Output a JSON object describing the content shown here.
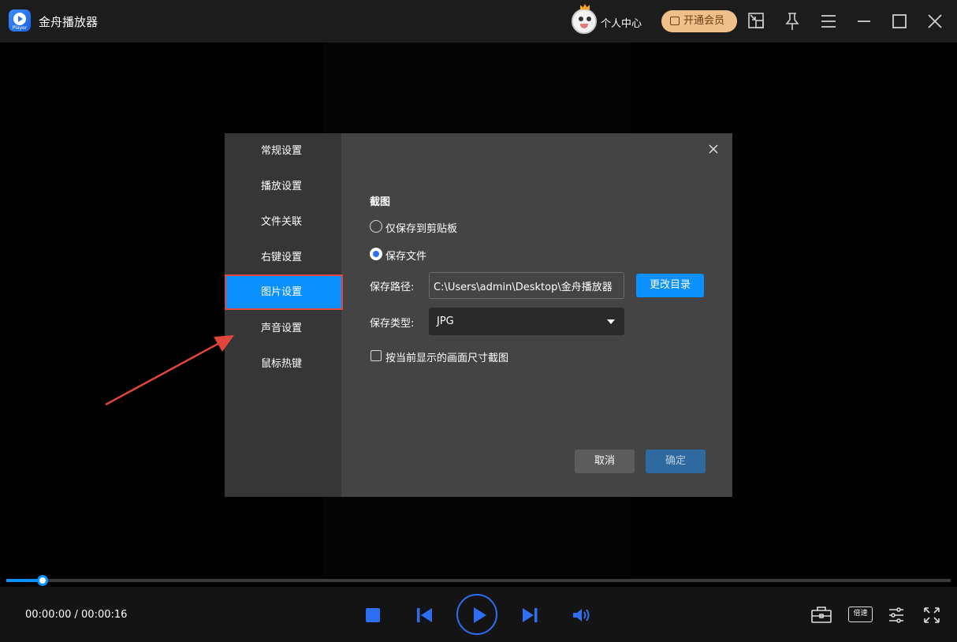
{
  "app": {
    "title": "金舟播放器",
    "logo_text": "Player"
  },
  "header": {
    "user_center": "个人中心",
    "vip_label": "开通会员"
  },
  "dialog": {
    "sidebar": [
      {
        "label": "常规设置"
      },
      {
        "label": "播放设置"
      },
      {
        "label": "文件关联"
      },
      {
        "label": "右键设置"
      },
      {
        "label": "图片设置"
      },
      {
        "label": "声音设置"
      },
      {
        "label": "鼠标热键"
      }
    ],
    "active_item": "图片设置",
    "section_title": "截图",
    "option_clipboard": "仅保存到剪贴板",
    "option_file": "保存文件",
    "selected_option": "保存文件",
    "save_path_label": "保存路径:",
    "save_path_value": "C:\\Users\\admin\\Desktop\\金舟播放器",
    "change_dir_label": "更改目录",
    "save_type_label": "保存类型:",
    "save_type_value": "JPG",
    "checkbox_label": "按当前显示的画面尺寸截图",
    "checkbox_checked": false,
    "cancel_label": "取消",
    "ok_label": "确定"
  },
  "player": {
    "time_display": "00:00:00 / 00:00:16",
    "progress_fraction": 0.038,
    "speed_label": "倍速"
  },
  "colors": {
    "accent": "#0a90ff",
    "highlight_border": "#e2463a",
    "control_blue": "#2e6ef2"
  }
}
